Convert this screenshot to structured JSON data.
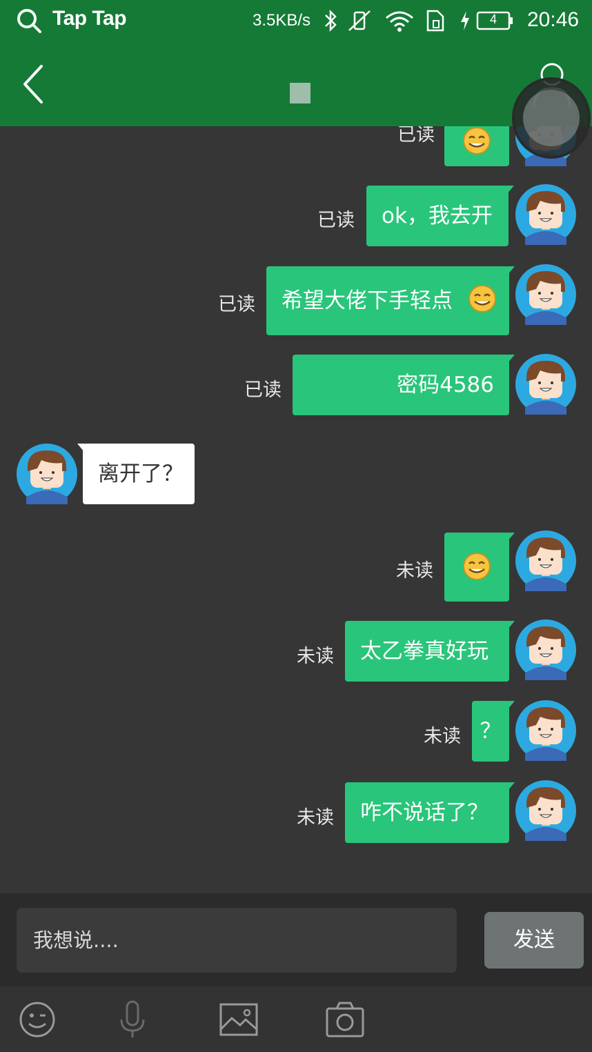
{
  "status_bar": {
    "brand": "Tap Tap",
    "net_speed": "3.5KB/s",
    "battery": "4",
    "time": "20:46"
  },
  "header": {
    "title": ""
  },
  "messages": [
    {
      "side": "right",
      "status": "已读",
      "text": "",
      "emoji": "smile-emoji"
    },
    {
      "side": "right",
      "status": "已读",
      "text": "ok，我去开"
    },
    {
      "side": "right",
      "status": "已读",
      "text": "希望大佬下手轻点",
      "emoji": "smile-emoji"
    },
    {
      "side": "right",
      "status": "已读",
      "text": "密码4586"
    },
    {
      "side": "left",
      "text": "离开了？"
    },
    {
      "side": "right",
      "status": "未读",
      "text": "",
      "emoji": "smile-emoji"
    },
    {
      "side": "right",
      "status": "未读",
      "text": "太乙拳真好玩"
    },
    {
      "side": "right",
      "status": "未读",
      "text": "？"
    },
    {
      "side": "right",
      "status": "未读",
      "text": "咋不说话了？"
    }
  ],
  "composer": {
    "placeholder": "我想说....",
    "send_label": "发送"
  },
  "toolbar": {
    "icons": [
      "emoji-icon",
      "microphone-icon",
      "image-icon",
      "camera-icon"
    ]
  },
  "colors": {
    "header": "#157a36",
    "bubble_self": "#29c57a",
    "bubble_other": "#ffffff",
    "background": "#363636"
  }
}
